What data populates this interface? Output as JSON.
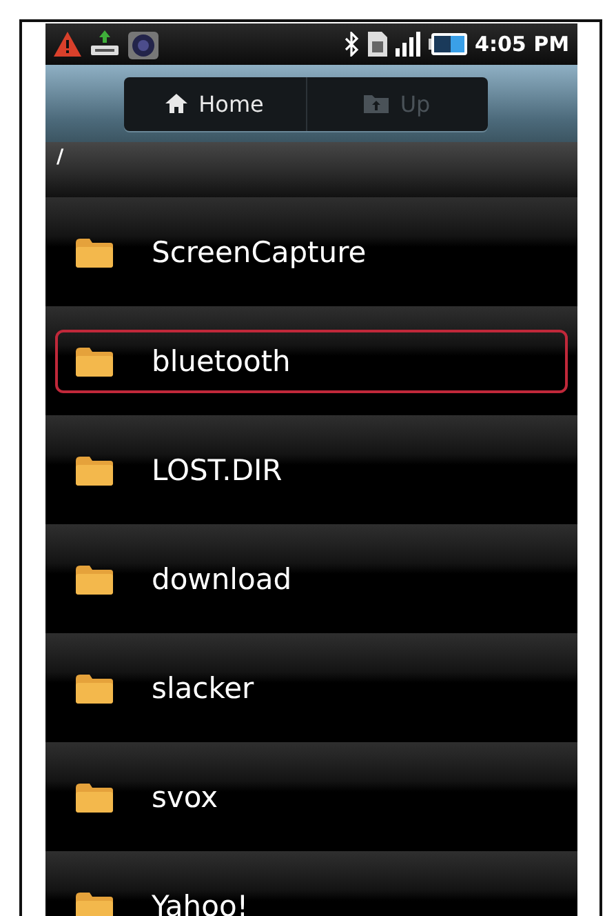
{
  "status_bar": {
    "time": "4:05 PM"
  },
  "toolbar": {
    "buttons": [
      {
        "kind": "home",
        "label": "Home",
        "disabled": false
      },
      {
        "kind": "up",
        "label": "Up",
        "disabled": true
      }
    ]
  },
  "path": "/",
  "folders": [
    {
      "name": "ScreenCapture",
      "selected": false
    },
    {
      "name": "bluetooth",
      "selected": true
    },
    {
      "name": "LOST.DIR",
      "selected": false
    },
    {
      "name": "download",
      "selected": false
    },
    {
      "name": "slacker",
      "selected": false
    },
    {
      "name": "svox",
      "selected": false
    },
    {
      "name": "Yahoo!",
      "selected": false
    }
  ]
}
